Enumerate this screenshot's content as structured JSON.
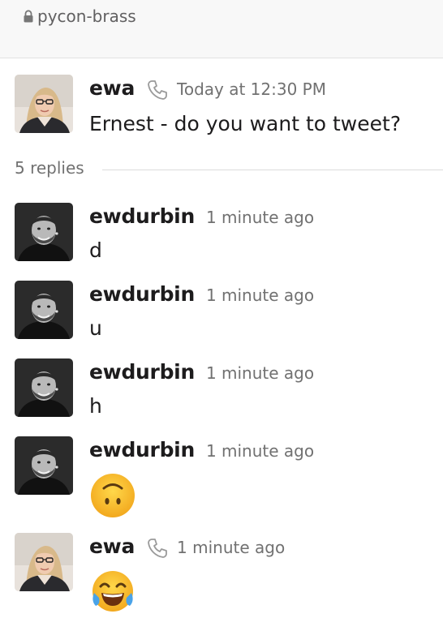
{
  "channel": {
    "name": "pycon-brass",
    "icon": "lock-icon"
  },
  "parent": {
    "author": "ewa",
    "timestamp": "Today at 12:30 PM",
    "text": "Ernest - do you want to tweet?",
    "call_icon": "phone-icon"
  },
  "replies_label": "5 replies",
  "replies": [
    {
      "author": "ewdurbin",
      "timestamp": "1 minute ago",
      "text": "d"
    },
    {
      "author": "ewdurbin",
      "timestamp": "1 minute ago",
      "text": "u"
    },
    {
      "author": "ewdurbin",
      "timestamp": "1 minute ago",
      "text": "h"
    },
    {
      "author": "ewdurbin",
      "timestamp": "1 minute ago",
      "emoji": "upside-down-face"
    },
    {
      "author": "ewa",
      "timestamp": "1 minute ago",
      "emoji": "face-with-tears-of-joy",
      "call_icon": "phone-icon"
    }
  ],
  "colors": {
    "text": "#1d1c1d",
    "muted": "#717171",
    "header_bg": "#f8f8f8",
    "emoji_yellow": "#f7c02b"
  }
}
